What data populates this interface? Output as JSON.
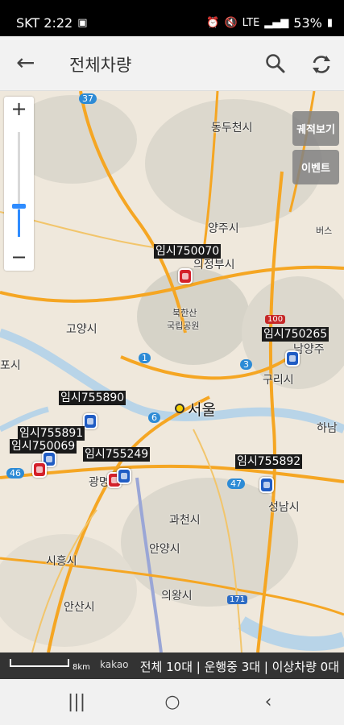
{
  "status": {
    "carrier_time": "SKT 2:22",
    "battery": "53%",
    "network": "LTE",
    "icons": [
      "image-icon",
      "alarm-icon",
      "mute-icon",
      "volte-icon",
      "signal-icon",
      "battery-icon"
    ]
  },
  "app_bar": {
    "title": "전체차량",
    "back_icon": "arrow-left-icon",
    "search_icon": "search-icon",
    "refresh_icon": "refresh-icon"
  },
  "map": {
    "side_buttons": {
      "track_view": "궤적보기",
      "event": "이벤트"
    },
    "zoom": {
      "plus": "+",
      "minus": "−",
      "level_fraction": 0.25
    },
    "places": {
      "dongducheon": "동두천시",
      "yangju": "양주시",
      "uijeongbu": "의정부시",
      "bukhansan": "북한산",
      "bukhansan_park": "국립공원",
      "goyang": "고양시",
      "seoul": "서울",
      "guri": "구리시",
      "namyangju": "남양주",
      "hanam": "하남",
      "gwacheon": "과천시",
      "seongnam": "성남시",
      "anyang": "안양시",
      "uiwang": "의왕시",
      "siheung": "시흥시",
      "ansan": "안산시",
      "gwangmyeong": "광명",
      "bucheon_partial": "포시",
      "beoseu": "버스",
      "gimpo_partial": "김포"
    },
    "vehicles": [
      {
        "label": "임시750070",
        "color": "red"
      },
      {
        "label": "임시750265",
        "color": "blue"
      },
      {
        "label": "임시755890",
        "color": "blue"
      },
      {
        "label": "임시755891",
        "color": "blue"
      },
      {
        "label": "임시750069",
        "color": "red"
      },
      {
        "label": "임시755249",
        "color": "red"
      },
      {
        "label": "임시755892",
        "color": "blue"
      }
    ],
    "road_numbers": [
      "37",
      "1",
      "3",
      "6",
      "46",
      "47",
      "100",
      "171"
    ]
  },
  "summary": {
    "text": "전체 10대 | 운행중 3대 | 이상차량 0대",
    "scale": "8km",
    "logo": "kakao"
  },
  "nav_bar": {
    "recents": "|||",
    "home": "○",
    "back": "‹"
  },
  "colors": {
    "highway": "#f5a623",
    "water": "#b8d4e8",
    "land": "#efe8dc",
    "mountain": "#d9d6cc",
    "accent": "#2f8cff"
  }
}
